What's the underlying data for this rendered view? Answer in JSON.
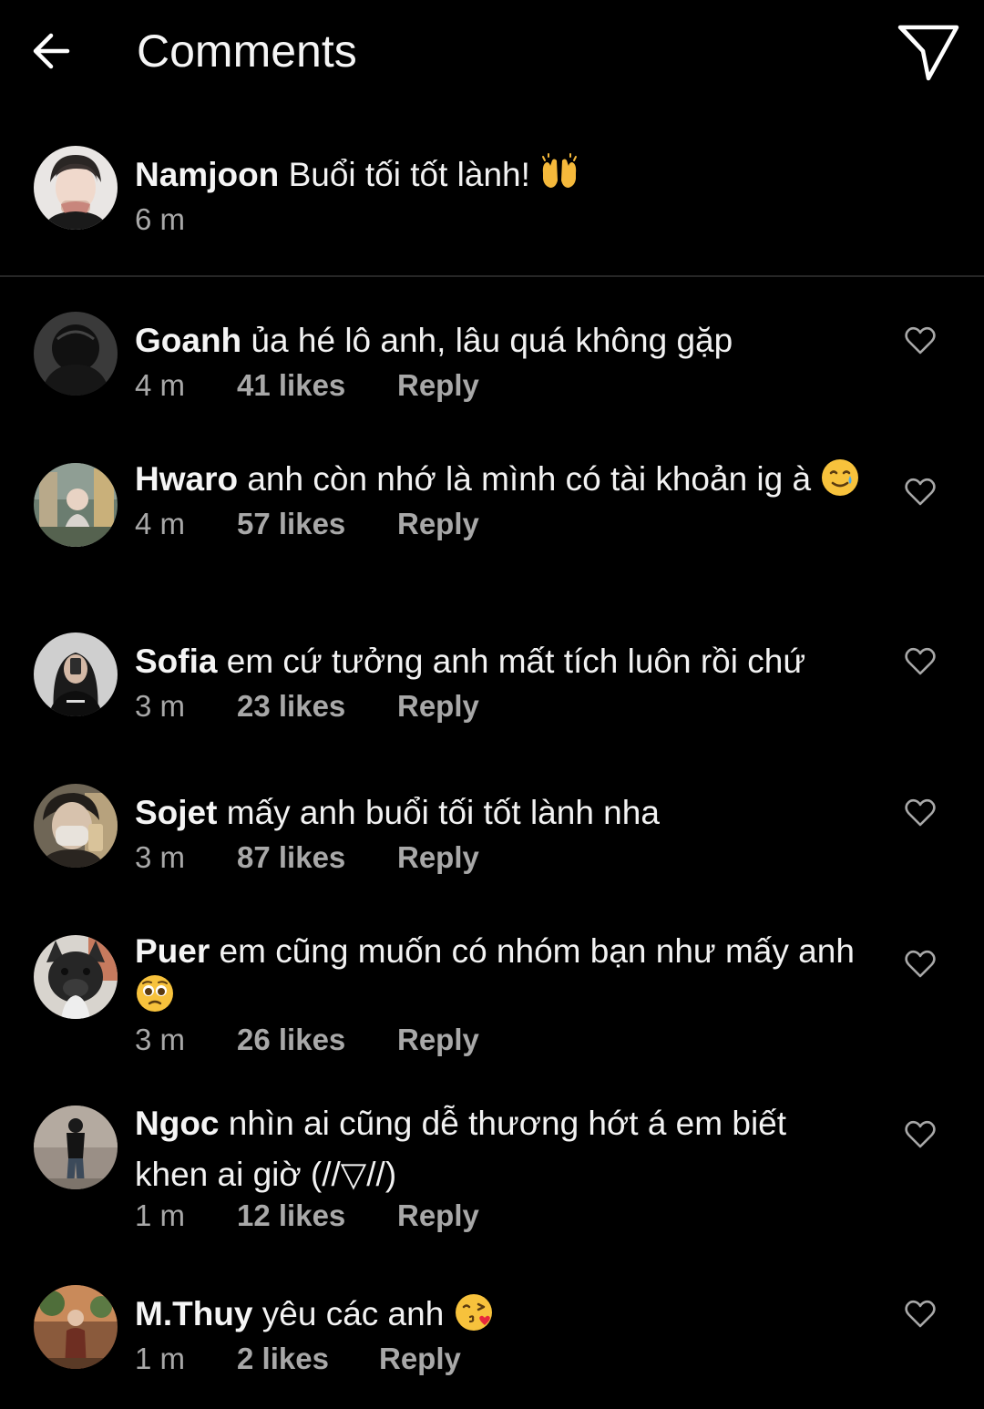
{
  "header": {
    "title": "Comments",
    "back_icon": "arrow-left-icon",
    "share_icon": "paper-plane-icon"
  },
  "caption": {
    "username": "Namjoon",
    "text": "Buổi tối tốt lành!",
    "emoji": "raising-hands-emoji",
    "time": "6 m"
  },
  "comments": [
    {
      "username": "Goanh",
      "text": "ủa hé lô anh, lâu quá không gặp",
      "time": "4 m",
      "likes": "41 likes",
      "reply": "Reply"
    },
    {
      "username": "Hwaro",
      "text": "anh còn nhớ là mình có tài khoản ig à",
      "emoji": "smiling-face-with-tear-emoji",
      "time": "4 m",
      "likes": "57 likes",
      "reply": "Reply"
    },
    {
      "username": "Sofia",
      "text": "em cứ tưởng anh mất tích luôn rồi chứ",
      "time": "3 m",
      "likes": "23 likes",
      "reply": "Reply"
    },
    {
      "username": "Sojet",
      "text": "mấy anh buổi tối tốt lành nha",
      "time": "3 m",
      "likes": "87 likes",
      "reply": "Reply"
    },
    {
      "username": "Puer",
      "text": "em cũng muốn có nhóm bạn như mấy anh",
      "emoji": "pleading-face-emoji",
      "time": "3 m",
      "likes": "26 likes",
      "reply": "Reply"
    },
    {
      "username": "Ngoc",
      "text": "nhìn ai cũng dễ thương hớt á em biết khen ai giờ (//▽//)",
      "time": "1 m",
      "likes": "12 likes",
      "reply": "Reply"
    },
    {
      "username": "M.Thuy",
      "text": "yêu các anh",
      "emoji": "face-blowing-kiss-emoji",
      "time": "1 m",
      "likes": "2 likes",
      "reply": "Reply"
    }
  ],
  "colors": {
    "background": "#000000",
    "primary_text": "#f2f2f2",
    "secondary_text": "#a8a8a8",
    "divider": "#262626"
  }
}
